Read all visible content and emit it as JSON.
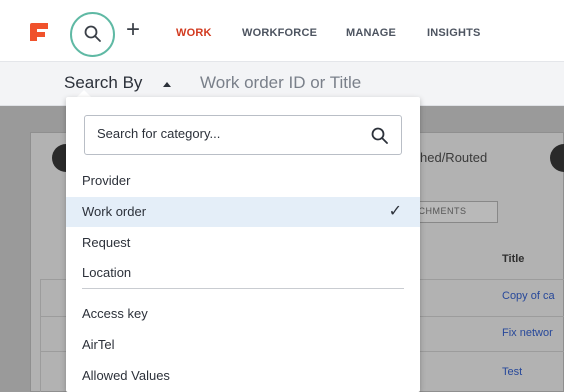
{
  "nav": {
    "items": [
      {
        "label": "WORK",
        "active": true
      },
      {
        "label": "WORKFORCE",
        "active": false
      },
      {
        "label": "MANAGE",
        "active": false
      },
      {
        "label": "INSIGHTS",
        "active": false
      }
    ],
    "icons": {
      "logo": "brand-logo",
      "search": "search-icon",
      "add": "plus-icon"
    }
  },
  "searchbar": {
    "search_by_label": "Search By",
    "placeholder": "Work order ID or Title"
  },
  "dropdown": {
    "search_placeholder": "Search for category...",
    "group1": [
      {
        "label": "Provider",
        "selected": false
      },
      {
        "label": "Work order",
        "selected": true
      },
      {
        "label": "Request",
        "selected": false
      },
      {
        "label": "Location",
        "selected": false
      }
    ],
    "group2": [
      {
        "label": "Access key"
      },
      {
        "label": "AirTel"
      },
      {
        "label": "Allowed Values"
      }
    ]
  },
  "background": {
    "status_text": "hed/Routed",
    "tab_label": "ACHMENTS",
    "column_title": "Title",
    "rows": [
      "Copy of ca",
      "Fix networ",
      "Test"
    ]
  },
  "colors": {
    "accent": "#d23a1f",
    "logo": "#f0522c",
    "focus_ring": "#5fb9a4",
    "selected_row": "#e4eef8",
    "link": "#27489a"
  }
}
